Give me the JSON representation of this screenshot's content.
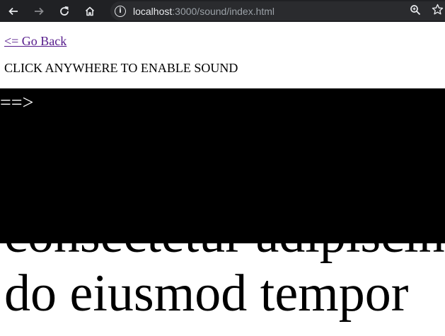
{
  "browser": {
    "url_host": "localhost",
    "url_rest": ":3000/sound/index.html",
    "back_glyph": "arrow-left-icon",
    "forward_glyph": "arrow-right-icon",
    "reload_glyph": "reload-icon",
    "home_glyph": "home-icon",
    "info_glyph": "i"
  },
  "page": {
    "back_link": "<= Go Back",
    "instruction": "CLICK ANYWHERE TO ENABLE SOUND",
    "arrow_text": "==>",
    "big_line_1": "consectetur adipiscing",
    "big_line_2": "do eiusmod tempor"
  },
  "colors": {
    "toolbar_bg": "#202124",
    "link": "#551a8b",
    "overlay": "#000000"
  }
}
